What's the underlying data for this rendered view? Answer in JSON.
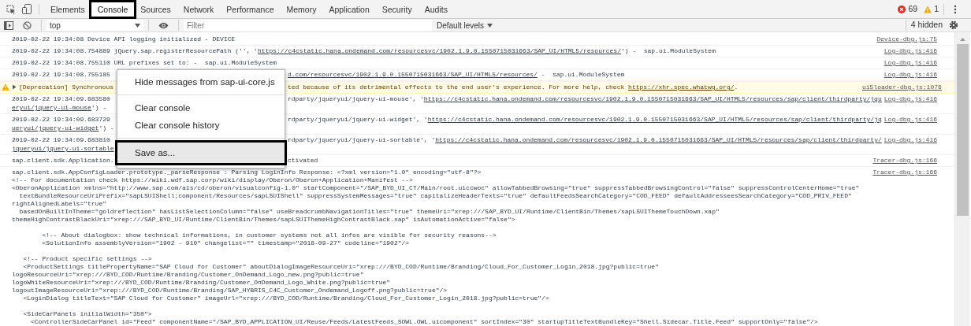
{
  "toolbar": {
    "tabs": [
      {
        "label": "Elements",
        "selected": false
      },
      {
        "label": "Console",
        "selected": true
      },
      {
        "label": "Sources",
        "selected": false
      },
      {
        "label": "Network",
        "selected": false
      },
      {
        "label": "Performance",
        "selected": false
      },
      {
        "label": "Memory",
        "selected": false
      },
      {
        "label": "Application",
        "selected": false
      },
      {
        "label": "Security",
        "selected": false
      },
      {
        "label": "Audits",
        "selected": false
      }
    ],
    "errors": "69",
    "warnings": "1"
  },
  "filter_bar": {
    "context": "top",
    "filter_placeholder": "Filter",
    "levels": "Default levels",
    "hidden_count": "4 hidden"
  },
  "messages": [
    {
      "kind": "info",
      "source": "Device-dbg.js:75",
      "lines": [
        {
          "before": [
            {
              "text": "2019-02-22 19:34:08 Device API logging initialized - DEVICE",
              "link": false
            }
          ]
        }
      ]
    },
    {
      "kind": "info",
      "source": "Log-dbg.js:416",
      "lines": [
        {
          "before": [
            {
              "text": "2019-02-22 19:34:08.754889 jQuery.sap.registerResourcePath ('', '",
              "link": false
            },
            {
              "text": "https://c4cstatic.hana.ondemand.com/resourcesvc/1902.1.9.0.1550715031663/SAP_UI/HTML5/resources/",
              "link": true
            },
            {
              "text": "') -  sap.ui.ModuleSystem",
              "link": false
            }
          ]
        }
      ]
    },
    {
      "kind": "info",
      "source": "Log-dbg.js:416",
      "lines": [
        {
          "before": [
            {
              "text": "2019-02-22 19:34:08.755110 URL prefixes set to: -  sap.ui.ModuleSystem",
              "link": false
            }
          ]
        }
      ]
    },
    {
      "kind": "info",
      "source": "Log-dbg.js:416",
      "lines": [
        {
          "before": [
            {
              "text": "2019-02-22 19:34:08.755185",
              "link": false
            }
          ],
          "after": [
            {
              "text": "d.com/resourcesvc/1902.1.9.0.1550715031663/SAP_UI/HTML5/resources/",
              "link": true
            },
            {
              "text": " -  sap.ui.ModuleSystem",
              "link": false
            }
          ]
        }
      ]
    },
    {
      "kind": "warning",
      "expanded": false,
      "source": "ui5loader-dbg.js:1076",
      "lines": [
        {
          "before": [
            {
              "text": "[Deprecation] Synchronous",
              "link": false
            }
          ],
          "after": [
            {
              "text": "ted because of its detrimental effects to the end user's experience. For more help, check ",
              "link": false
            },
            {
              "text": "https://xhr.spec.whatwg.org/",
              "link": true
            },
            {
              "text": ".",
              "link": false
            }
          ]
        }
      ]
    },
    {
      "kind": "info",
      "source": "Log-dbg.js:416",
      "lines": [
        {
          "before": [
            {
              "text": "2019-02-22 19:34:09.683580",
              "link": false
            }
          ],
          "after": [
            {
              "text": "rdparty/jqueryui/jquery-ui-mouse', '",
              "link": false
            },
            {
              "text": "https://c4cstatic.hana.ondemand.com/resourcesvc/1902.1.9.0.1550715031663/SAP_UI/HTML5/resources/sap/client/thirdparty/jqu",
              "link": true
            }
          ]
        },
        {
          "before": [
            {
              "text": "eryui/jquery-ui-mouse",
              "link": true
            },
            {
              "text": "') -",
              "link": false
            }
          ]
        }
      ]
    },
    {
      "kind": "info",
      "source": "Log-dbg.js:416",
      "lines": [
        {
          "before": [
            {
              "text": "2019-02-22 19:34:09.683729",
              "link": false
            }
          ],
          "after": [
            {
              "text": "rdparty/jqueryui/jquery-ui-widget', '",
              "link": false
            },
            {
              "text": "https://c4cstatic.hana.ondemand.com/resourcesvc/1902.1.9.0.1550715031663/SAP_UI/HTML5/resources/sap/client/thirdparty/jq",
              "link": true
            }
          ]
        },
        {
          "before": [
            {
              "text": "ueryui/jquery-ui-widget",
              "link": true
            },
            {
              "text": "') -",
              "link": false
            }
          ]
        }
      ]
    },
    {
      "kind": "info",
      "source": "Log-dbg.js:416",
      "lines": [
        {
          "before": [
            {
              "text": "2019-02-22 19:34:09.683810",
              "link": false
            }
          ],
          "after": [
            {
              "text": "rdparty/jqueryui/jquery-ui-sortable', '",
              "link": false
            },
            {
              "text": "https://c4cstatic.hana.ondemand.com/resourcesvc/1902.1.9.0.1550715031663/SAP_UI/HTML5/resources/sap/client/thirdparty/",
              "link": true
            }
          ]
        },
        {
          "before": [
            {
              "text": "jqueryui/jquery-ui-sortable",
              "link": true
            }
          ]
        }
      ]
    },
    {
      "kind": "info",
      "source": "Tracer-dbg.js:166",
      "lines": [
        {
          "before": [
            {
              "text": "sap.client.sdk.Application.",
              "link": false
            }
          ],
          "after": [
            {
              "text": "ctivated",
              "link": false
            }
          ]
        }
      ]
    },
    {
      "kind": "info",
      "source": "Tracer-dbg.js:166",
      "lines": [
        {
          "before": [
            {
              "text": "sap.client.sdk.AppConfigLoader.prototype._parseResponse : Parsing LoginInfo Response: <?xml version=\"1.0\" encoding=\"utf-8\"?>",
              "link": false
            }
          ]
        }
      ],
      "body_blocks": [
        [
          "<!-- For documentation check https://wiki.wdf.sap.corp/wiki/display/Oberon/Oberon+Application+Manifest -->",
          "<OberonApplication xmlns=\"http://www.sap.com/a1s/cd/oberon/visualconfig-1.0\" startComponent=\"/SAP_BYD_UI_CT/Main/root.uiccwoc\" allowTabbedBrowsing=\"true\" suppressTabbedBrowsingControl=\"false\" suppressControlCenterHome=\"true\"",
          "  textBundleResourceUriPrefix=\"sapLSUIShell;component/Resources/sapLSUIShell\" suppressSystemMessages=\"true\" capitalizeHeaderTexts=\"true\" defaultFeedsSearchCategory=\"COD_FEED\" defaultAddresseesSearchCategory=\"COD_PRIV_FEED\"",
          "rightAlignedLabels=\"true\"",
          "  basedOnBuiltInTheme=\"goldreflection\" hasListSelectionColumn=\"false\" useBreadcrumbNavigationTitles=\"true\" themeUri=\"xrep:///SAP_BYD_UI/Runtime/ClientBin/Themes/sapLSUIThemeTouchDown.xap\"",
          "themeHighContrastBlackUri=\"xrep:///SAP_BYD_UI/Runtime/ClientBin/Themes/sapLSUIThemeHighContrastBlack.xap\" isAutomationActive=\"false\">"
        ],
        [
          "        <!-- About dialogbox: show technical informations, in customer systems not all infos are visible for security reasons-->",
          "        <SolutionInfo assemblyVersion=\"1902 - 910\" changelist=\"\" timestamp=\"2018-09-27\" codeline=\"1902\"/>"
        ],
        [
          "   <!-- Product specific settings -->",
          "   <ProductSettings titlePropertyName=\"SAP Cloud for Customer\" aboutDialogImageResourceUri=\"xrep:///BYD_COD/Runtime/Branding/Cloud_For_Customer_Login_2018.jpg?public=true\"",
          "logoResourceUri=\"xrep:///BYD_COD/Runtime/Branding/Customer_OnDemand_Logo_new.png?public=true\"",
          "logoWhiteResourceUri=\"xrep:///BYD_COD/Runtime/Branding/Customer_OnDemand_Logo_White.png?public=true\"",
          "logoutImageResourceUri=\"xrep:///BYD_COD/Runtime/Branding/SAP_HYBRIS_C4C_Customer_Ondemand_Logoff.png?public=true\"/>",
          "   <LoginDialog titleText=\"SAP Cloud for Customer\" imageUrl=\"xrep:///BYD_COD/Runtime/Branding/Cloud_For_Customer_Login_2018.jpg?public=true\"/>"
        ],
        [
          "   <SideCarPanels initialWidth=\"350\">",
          "     <ControllerSideCarPanel id=\"Feed\" componentName=\"/SAP_BYD_APPLICATION_UI/Reuse/Feeds/LatestFeeds_SOWL.OWL.uicomponent\" sortIndex=\"30\" startupTitleTextBundleKey=\"Shell.Sidecar.Title.Feed\" supportOnly=\"false\"/>"
        ]
      ]
    }
  ],
  "context_menu": {
    "groups": [
      [
        {
          "label": "Hide messages from sap-ui-core.js",
          "highlighted": false
        }
      ],
      [
        {
          "label": "Clear console",
          "highlighted": false
        },
        {
          "label": "Clear console history",
          "highlighted": false
        }
      ],
      [
        {
          "label": "Save as...",
          "highlighted": true
        }
      ]
    ]
  }
}
